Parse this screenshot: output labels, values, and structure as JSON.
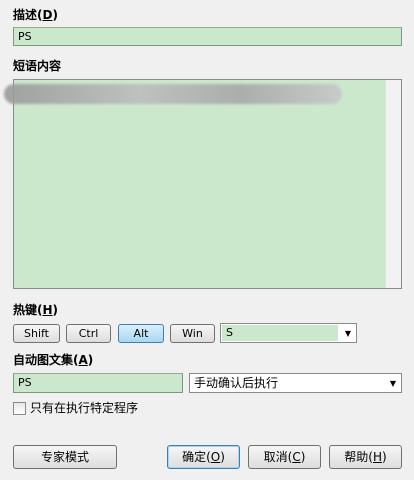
{
  "description": {
    "label": "描述",
    "mnemonic": "D",
    "value": "PS"
  },
  "phrase_content": {
    "label": "短语内容"
  },
  "hotkey": {
    "label": "热键",
    "mnemonic": "H",
    "modifiers": {
      "shift": "Shift",
      "ctrl": "Ctrl",
      "alt": "Alt",
      "win": "Win"
    },
    "alt_pressed": true,
    "key_value": "S"
  },
  "autotext": {
    "label": "自动图文集",
    "mnemonic": "A",
    "value": "PS",
    "mode_selected": "手动确认后执行"
  },
  "only_in_program": {
    "label": "只有在执行特定程序",
    "checked": false
  },
  "buttons": {
    "expert": "专家模式",
    "ok": "确定",
    "ok_mnemonic": "O",
    "cancel": "取消",
    "cancel_mnemonic": "C",
    "help": "帮助",
    "help_mnemonic": "H"
  },
  "colors": {
    "field_bg": "#cce8cc",
    "pressed_btn": "#a9d6f3"
  }
}
